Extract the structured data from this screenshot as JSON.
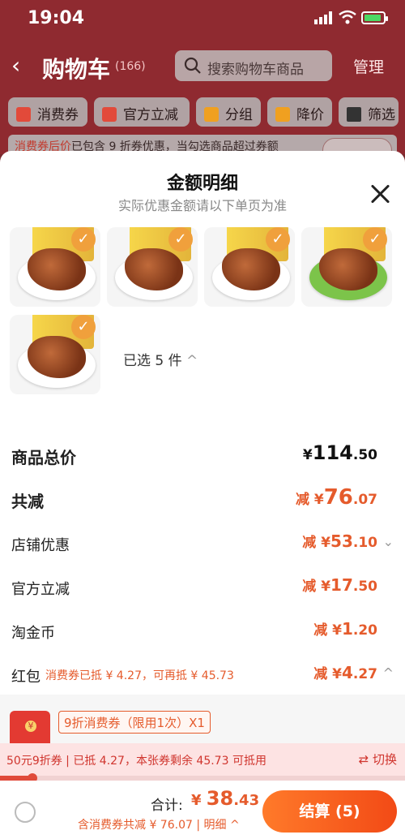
{
  "status_bar": {
    "time": "19:04"
  },
  "nav": {
    "back_icon": "chevron-left-icon",
    "title": "购物车",
    "count": "(166)",
    "search_placeholder": "搜索购物车商品",
    "manage": "管理"
  },
  "filters": [
    {
      "label": "消费券",
      "icon": "coupon-icon",
      "color": "#e24a3a"
    },
    {
      "label": "官方立减",
      "icon": "bolt-icon",
      "color": "#e24a3a"
    },
    {
      "label": "分组",
      "icon": "folder-icon",
      "color": "#f0a020"
    },
    {
      "label": "降价",
      "icon": "arrow-down-icon",
      "color": "#f0a020"
    },
    {
      "label": "筛选",
      "icon": "filter-icon",
      "color": "#333"
    }
  ],
  "notice": {
    "highlight": "消费券后价",
    "text": "已包含 9 折券优惠，当勾选商品超过券额"
  },
  "modal": {
    "title": "金额明细",
    "subtitle": "实际优惠金额请以下单页为准",
    "selected": "已选 5 件",
    "rows": {
      "total": {
        "label": "商品总价",
        "prefix": "¥",
        "main": "114",
        "dec": ".50"
      },
      "reduce": {
        "label": "共减",
        "prefix": "减 ¥",
        "main": "76",
        "dec": ".07"
      },
      "shop": {
        "label": "店铺优惠",
        "prefix": "减 ¥",
        "main": "53",
        "dec": ".10"
      },
      "official": {
        "label": "官方立减",
        "prefix": "减 ¥",
        "main": "17",
        "dec": ".50"
      },
      "coins": {
        "label": "淘金币",
        "prefix": "减 ¥",
        "main": "1",
        "dec": ".20"
      },
      "redpack": {
        "label": "红包",
        "note": "消费券已抵 ¥ 4.27，可再抵 ¥ 45.73",
        "prefix": "减 ¥",
        "main": "4",
        "dec": ".27"
      }
    },
    "coupon_tag": "9折消费券（限用1次）X1"
  },
  "strip": {
    "text": "50元9折券 | 已抵 4.27，本张券剩余 45.73 可抵用",
    "switch": "⇄ 切换"
  },
  "progress": {
    "fraction": 0.08
  },
  "footer": {
    "sum_label": "合计:",
    "sum_prefix": "¥ ",
    "sum_main": "38",
    "sum_dec": ".43",
    "sum_note": "含消费券共减 ¥ 76.07 | 明细 ^",
    "pay": "结算 (5)"
  }
}
